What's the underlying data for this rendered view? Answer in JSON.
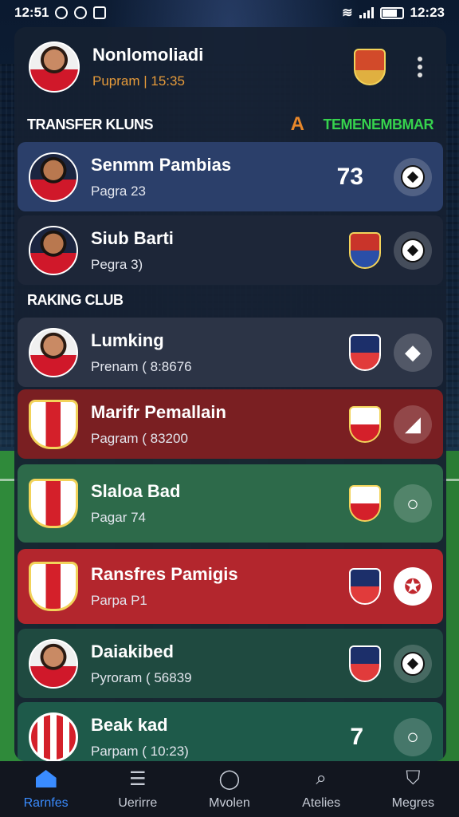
{
  "status": {
    "time": "12:51",
    "time_right": "12:23"
  },
  "header": {
    "name": "Nonlomoliadi",
    "sub": "Pupram | 15:35"
  },
  "section1": {
    "left": "TRANSFER KLUNS",
    "accent": "A",
    "right": "TEMENEMBMAR"
  },
  "section2": {
    "left": "RAKING CLUB"
  },
  "cards": [
    {
      "name": "Senmm Pambias",
      "sub": "Pagra 23",
      "score": "73",
      "bg": "#2b3f6a"
    },
    {
      "name": "Siub Barti",
      "sub": "Pegra 3)",
      "score": "",
      "bg": "#1d2638"
    },
    {
      "name": "Lumking",
      "sub": "Prenam ( 8:8676",
      "score": "",
      "bg": "#2c3446"
    },
    {
      "name": "Marifr Pemallain",
      "sub": "Pagram ( 83200",
      "score": "",
      "bg": "#7a1f22"
    },
    {
      "name": "Slaloa Bad",
      "sub": "Pagar 74",
      "score": "",
      "bg": "#2d6a4a"
    },
    {
      "name": "Ransfres Pamigis",
      "sub": "Parpa P1",
      "score": "",
      "bg": "#b3262d"
    },
    {
      "name": "Daiakibed",
      "sub": "Pyroram ( 56839",
      "score": "",
      "bg": "#1f4a40"
    },
    {
      "name": "Beak kad",
      "sub": "Parpam ( 10:23)",
      "score": "7",
      "bg": "#1e5a4a"
    }
  ],
  "nav": [
    {
      "label": "Rarnfes",
      "icon": "home-icon"
    },
    {
      "label": "Uerirre",
      "icon": "people-icon"
    },
    {
      "label": "Mvolen",
      "icon": "circle-icon"
    },
    {
      "label": "Atelies",
      "icon": "search-icon"
    },
    {
      "label": "Megres",
      "icon": "badge-icon"
    }
  ]
}
